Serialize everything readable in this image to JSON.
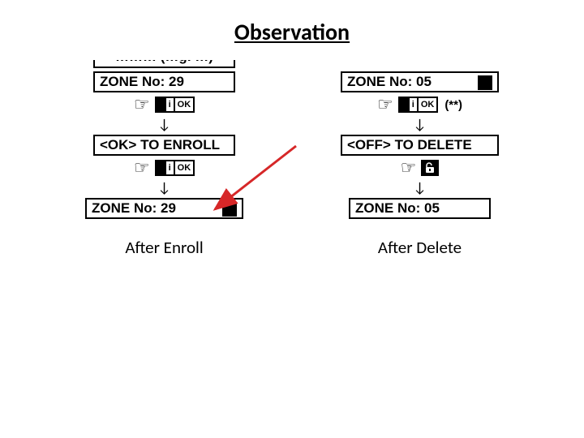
{
  "title": "Observation",
  "left": {
    "cropped_text": "……… (…g. …)",
    "zone1": "ZONE No: 29",
    "ok_icon_i": "i",
    "ok_icon_ok": "OK",
    "prompt": "<OK> TO ENROLL",
    "zone2": "ZONE No: 29",
    "caption": "After Enroll"
  },
  "right": {
    "partial_top": "",
    "zone1": "ZONE No: 05",
    "ok_icon_i": "i",
    "ok_icon_ok": "OK",
    "asterisks": "(**)",
    "prompt": "<OFF> TO DELETE",
    "lock_icon_name": "unlock-icon",
    "zone2": "ZONE No: 05",
    "caption": "After Delete"
  }
}
